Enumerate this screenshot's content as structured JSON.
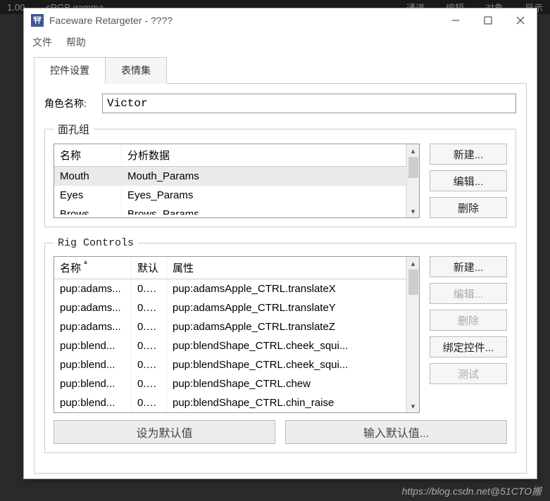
{
  "background_bar": {
    "items": [
      "1.00",
      "sRGB gamma",
      "通道",
      "编辑",
      "对象",
      "显示"
    ]
  },
  "window": {
    "title": "Faceware Retargeter - ????",
    "menu": {
      "file": "文件",
      "help": "帮助"
    },
    "controls": {
      "min": "—",
      "max": "□",
      "close": "✕"
    }
  },
  "tabs": {
    "active": "控件设置",
    "inactive": "表情集"
  },
  "role": {
    "label": "角色名称:",
    "value": "Victor"
  },
  "face_group": {
    "legend": "面孔组",
    "columns": {
      "name": "名称",
      "data": "分析数据"
    },
    "rows": [
      {
        "name": "Mouth",
        "data": "Mouth_Params",
        "selected": true
      },
      {
        "name": "Eyes",
        "data": "Eyes_Params",
        "selected": false
      },
      {
        "name": "Brows",
        "data": "Brows_Params",
        "selected": false
      }
    ],
    "buttons": {
      "new": "新建...",
      "edit": "编辑...",
      "delete": "删除"
    }
  },
  "rig": {
    "legend": "Rig Controls",
    "columns": {
      "name": "名称",
      "default": "默认",
      "attr": "属性"
    },
    "rows": [
      {
        "name": "pup:adams...",
        "def": "0.0...",
        "attr": "pup:adamsApple_CTRL.translateX"
      },
      {
        "name": "pup:adams...",
        "def": "0.0...",
        "attr": "pup:adamsApple_CTRL.translateY"
      },
      {
        "name": "pup:adams...",
        "def": "0.0...",
        "attr": "pup:adamsApple_CTRL.translateZ"
      },
      {
        "name": "pup:blend...",
        "def": "0.0...",
        "attr": "pup:blendShape_CTRL.cheek_squi..."
      },
      {
        "name": "pup:blend...",
        "def": "0.0...",
        "attr": "pup:blendShape_CTRL.cheek_squi..."
      },
      {
        "name": "pup:blend...",
        "def": "0.0...",
        "attr": "pup:blendShape_CTRL.chew"
      },
      {
        "name": "pup:blend...",
        "def": "0.0...",
        "attr": "pup:blendShape_CTRL.chin_raise"
      }
    ],
    "buttons": {
      "new": "新建...",
      "edit": "编辑...",
      "delete": "删除",
      "bind": "绑定控件...",
      "test": "测试"
    },
    "footer": {
      "set_default": "设为默认值",
      "input_default": "输入默认值..."
    }
  },
  "watermark": "https://blog.csdn.net@51CTO搬"
}
